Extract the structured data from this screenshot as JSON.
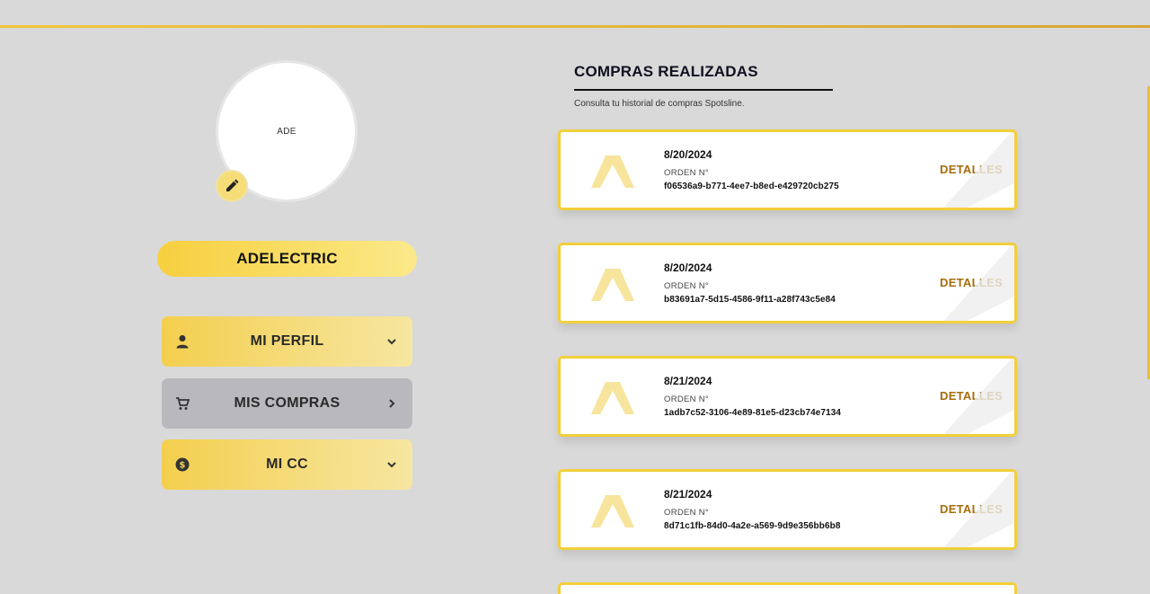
{
  "profile": {
    "avatar_initials": "ADE",
    "username": "ADELECTRIC"
  },
  "nav": {
    "items": [
      {
        "label": "MI PERFIL",
        "icon": "person-icon",
        "indicator": "chevron-down-icon",
        "active": false
      },
      {
        "label": "MIS COMPRAS",
        "icon": "cart-icon",
        "indicator": "chevron-right-icon",
        "active": true
      },
      {
        "label": "MI CC",
        "icon": "coin-icon",
        "indicator": "chevron-down-icon",
        "active": false
      }
    ]
  },
  "orders_section": {
    "title": "COMPRAS REALIZADAS",
    "subtitle": "Consulta tu historial de compras Spotsline."
  },
  "orders": [
    {
      "date": "8/20/2024",
      "label": "ORDEN N°",
      "id": "f06536a9-b771-4ee7-b8ed-e429720cb275",
      "action": "DETALLES"
    },
    {
      "date": "8/20/2024",
      "label": "ORDEN N°",
      "id": "b83691a7-5d15-4586-9f11-a28f743c5e84",
      "action": "DETALLES"
    },
    {
      "date": "8/21/2024",
      "label": "ORDEN N°",
      "id": "1adb7c52-3106-4e89-81e5-d23cb74e7134",
      "action": "DETALLES"
    },
    {
      "date": "8/21/2024",
      "label": "ORDEN N°",
      "id": "8d71c1fb-84d0-4a2e-a569-9d9e356bb6b8",
      "action": "DETALLES"
    }
  ],
  "colors": {
    "accent_gold": "#f2cf3a",
    "details_text": "#a56d0c",
    "background": "#d9d9d9"
  }
}
